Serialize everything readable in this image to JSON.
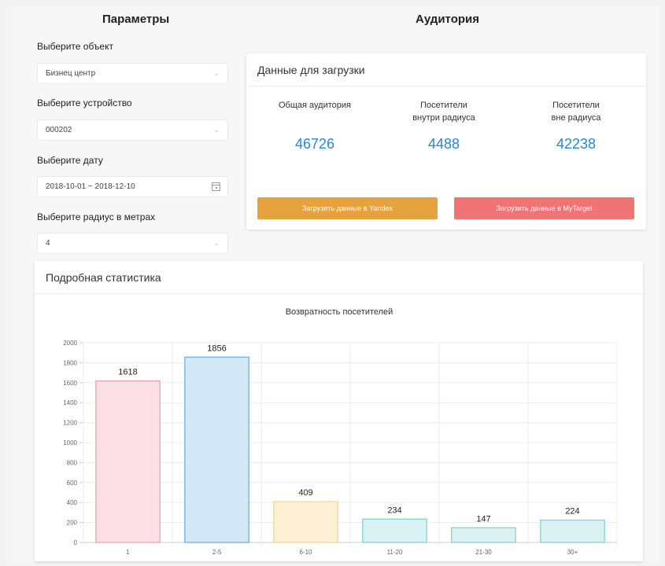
{
  "params": {
    "title": "Параметры",
    "object_label": "Выберите объект",
    "object_value": "Бизнец центр",
    "device_label": "Выберите устройство",
    "device_value": "000202",
    "date_label": "Выберите дату",
    "date_value": "2018-10-01 ~ 2018-12-10",
    "radius_label": "Выберите радиус в метрах",
    "radius_value": "4"
  },
  "audience": {
    "title": "Аудитория",
    "card_title": "Данные для загрузки",
    "stats": [
      {
        "label": "Общая аудитория",
        "value": "46726"
      },
      {
        "label": "Посетители внутри радиуса",
        "value": "4488"
      },
      {
        "label": "Посетители вне радиуса",
        "value": "42238"
      }
    ],
    "yandex_button": "Загрузить данные в Yandex",
    "mytarget_button": "Загрузить данные в MyTarget"
  },
  "colors": {
    "value_blue": "#2a86d4",
    "yandex_orange": "#e6a23c",
    "mytarget_red": "#f07474"
  },
  "stats_card": {
    "title": "Подробная статистика"
  },
  "chart_data": {
    "type": "bar",
    "title": "Возвратность посетителей",
    "categories": [
      "1",
      "2-5",
      "6-10",
      "11-20",
      "21-30",
      "30+"
    ],
    "values": [
      1618,
      1856,
      409,
      234,
      147,
      224
    ],
    "ylim": [
      0,
      2000
    ],
    "yticks": [
      0,
      200,
      400,
      600,
      800,
      1000,
      1200,
      1400,
      1600,
      1800,
      2000
    ],
    "grid": true,
    "bar_fill": [
      "#fde0e6",
      "#d3e9f8",
      "#fdf0d5",
      "#d9f1f1",
      "#d9f1f1",
      "#d9f1f1"
    ],
    "bar_stroke": [
      "#f29aae",
      "#62aee0",
      "#f5d48a",
      "#7fd0d0",
      "#7fd0d0",
      "#7fd0d0"
    ]
  }
}
